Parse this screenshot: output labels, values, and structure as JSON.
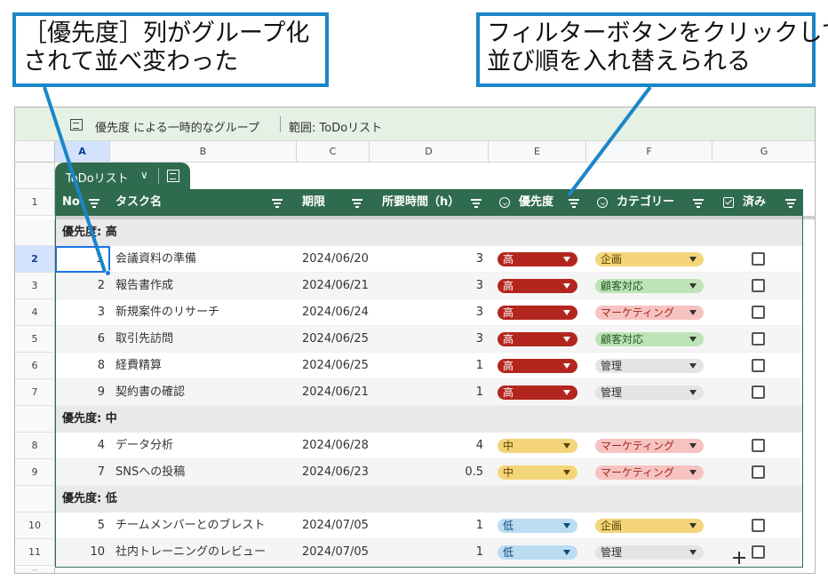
{
  "callouts": {
    "left": [
      "［優先度］列がグループ化",
      "されて並べ変わった"
    ],
    "right": [
      "フィルターボタンをクリックして",
      "並び順を入れ替えられる"
    ]
  },
  "topbar": {
    "title": "優先度 による一時的なグループ",
    "range": "範囲:  ToDoリスト"
  },
  "columns": [
    "A",
    "B",
    "C",
    "D",
    "E",
    "F",
    "G"
  ],
  "table_tab": {
    "name": "ToDoリスト",
    "chevron": "∨"
  },
  "headers": {
    "row_num": "1",
    "no": "No",
    "task": "タスク名",
    "due": "期限",
    "time": "所要時間（h）",
    "priority": "優先度",
    "category": "カテゴリー",
    "done": "済み"
  },
  "groups": [
    {
      "label": "優先度: 高",
      "rows": [
        {
          "row": "2",
          "no": "1",
          "task": "会議資料の準備",
          "due": "2024/06/20",
          "time": "3",
          "priority": "高",
          "category": "企画",
          "done": false
        },
        {
          "row": "3",
          "no": "2",
          "task": "報告書作成",
          "due": "2024/06/21",
          "time": "3",
          "priority": "高",
          "category": "顧客対応",
          "done": false
        },
        {
          "row": "4",
          "no": "3",
          "task": "新規案件のリサーチ",
          "due": "2024/06/24",
          "time": "3",
          "priority": "高",
          "category": "マーケティング",
          "done": false
        },
        {
          "row": "5",
          "no": "6",
          "task": "取引先訪問",
          "due": "2024/06/25",
          "time": "3",
          "priority": "高",
          "category": "顧客対応",
          "done": false
        },
        {
          "row": "6",
          "no": "8",
          "task": "経費精算",
          "due": "2024/06/25",
          "time": "1",
          "priority": "高",
          "category": "管理",
          "done": false
        },
        {
          "row": "7",
          "no": "9",
          "task": "契約書の確認",
          "due": "2024/06/21",
          "time": "1",
          "priority": "高",
          "category": "管理",
          "done": false
        }
      ]
    },
    {
      "label": "優先度: 中",
      "rows": [
        {
          "row": "8",
          "no": "4",
          "task": "データ分析",
          "due": "2024/06/28",
          "time": "4",
          "priority": "中",
          "category": "マーケティング",
          "done": false
        },
        {
          "row": "9",
          "no": "7",
          "task": "SNSへの投稿",
          "due": "2024/06/23",
          "time": "0.5",
          "priority": "中",
          "category": "マーケティング",
          "done": false
        }
      ]
    },
    {
      "label": "優先度: 低",
      "rows": [
        {
          "row": "10",
          "no": "5",
          "task": "チームメンバーとのブレスト",
          "due": "2024/07/05",
          "time": "1",
          "priority": "低",
          "category": "企画",
          "done": false
        },
        {
          "row": "11",
          "no": "10",
          "task": "社内トレーニングのレビュー",
          "due": "2024/07/05",
          "time": "1",
          "priority": "低",
          "category": "管理",
          "done": false
        }
      ]
    }
  ],
  "colors": {
    "accent": "#2f6b4f",
    "callout_border": "#1a86c8",
    "priority": {
      "高": {
        "bg": "#b3261e",
        "fg": "#ffffff"
      },
      "中": {
        "bg": "#f5d57a",
        "fg": "#5a4300"
      },
      "低": {
        "bg": "#bcdcf2",
        "fg": "#0b4a78"
      }
    },
    "category": {
      "企画": {
        "bg": "#f5d57a",
        "fg": "#5a4300"
      },
      "顧客対応": {
        "bg": "#bfe3b8",
        "fg": "#1f5a1f"
      },
      "マーケティング": {
        "bg": "#f7c3c0",
        "fg": "#a1261e"
      },
      "管理": {
        "bg": "#e4e4e4",
        "fg": "#333333"
      }
    }
  }
}
